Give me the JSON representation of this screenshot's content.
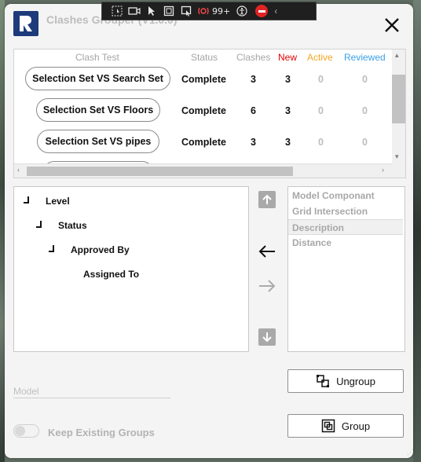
{
  "window": {
    "title": "Clashes Grouper (V1.0.0)"
  },
  "overlay_toolbar": {
    "icons": [
      "screen-select-icon",
      "video-icon",
      "pointer-icon",
      "window-select-icon",
      "region-select-icon",
      "notifications-icon",
      "accessibility-icon",
      "stop-icon"
    ],
    "notification_count": "99+"
  },
  "clash_table": {
    "headers": {
      "clash_test": "Clash Test",
      "status": "Status",
      "clashes": "Clashes",
      "new": "New",
      "active": "Active",
      "reviewed": "Reviewed"
    },
    "header_colors": {
      "new": "#e00000",
      "active": "#f5a623",
      "reviewed": "#3aa0e8"
    },
    "rows": [
      {
        "name": "Selection Set VS Search Set",
        "status": "Complete",
        "clashes": "3",
        "new": "3",
        "active": "0",
        "reviewed": "0"
      },
      {
        "name": "Selection Set VS Floors",
        "status": "Complete",
        "clashes": "6",
        "new": "3",
        "active": "0",
        "reviewed": "0"
      },
      {
        "name": "Selection Set VS pipes",
        "status": "Complete",
        "clashes": "3",
        "new": "3",
        "active": "0",
        "reviewed": "0"
      }
    ]
  },
  "grouping_tree": {
    "levels": [
      "Level",
      "Status",
      "Approved By",
      "Assigned To"
    ]
  },
  "available_fields": {
    "items": [
      "Model Componant",
      "Grid Intersection",
      "Description",
      "Distance"
    ],
    "selected": "Description"
  },
  "model_field": {
    "placeholder": "Model",
    "value": ""
  },
  "actions": {
    "ungroup_label": "Ungroup",
    "group_label": "Group"
  },
  "keep_groups": {
    "label": "Keep Existing Groups",
    "enabled": false
  }
}
